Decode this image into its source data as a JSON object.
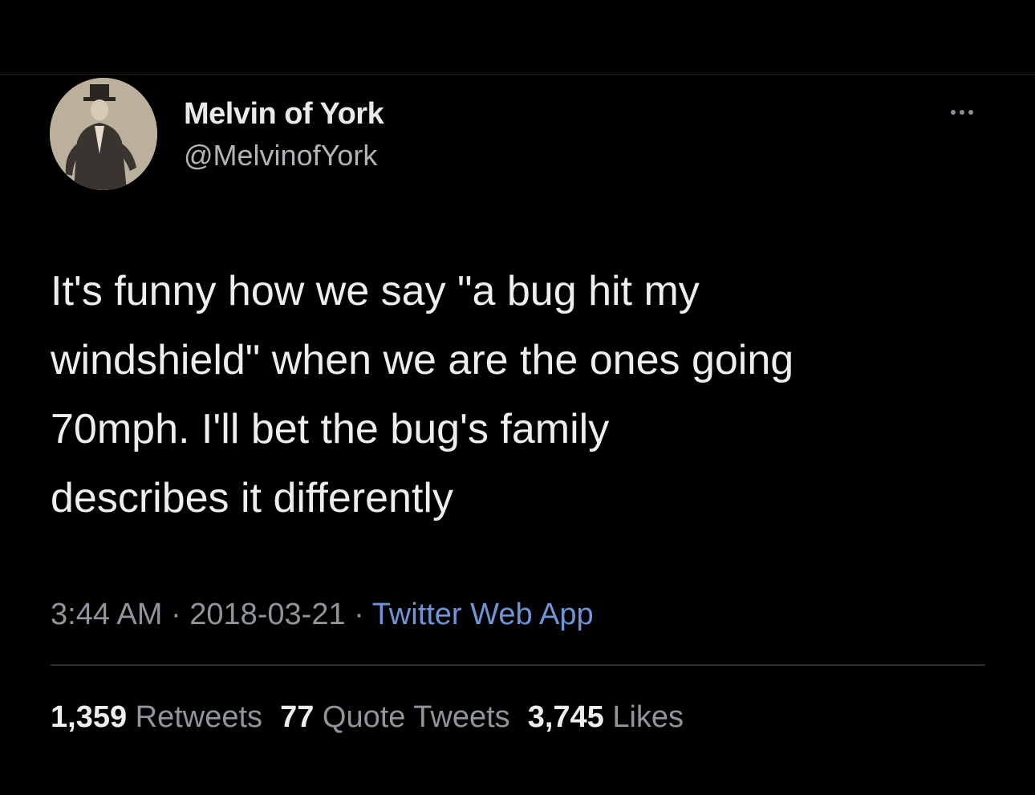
{
  "tweet": {
    "author": {
      "display_name": "Melvin of York",
      "handle": "@MelvinofYork"
    },
    "text": "It's funny how we say \"a bug hit my\nwindshield\" when we are the ones going\n70mph. I'll bet the bug's family\ndescribes it differently",
    "time": "3:44 AM",
    "date": "2018-03-21",
    "separator": "·",
    "source": "Twitter Web App",
    "stats": {
      "retweets_count": "1,359",
      "retweets_label": "Retweets",
      "quotes_count": "77",
      "quotes_label": "Quote Tweets",
      "likes_count": "3,745",
      "likes_label": "Likes"
    },
    "icons": {
      "more": "more-horizontal-icon",
      "avatar": "avatar-image"
    }
  },
  "colors": {
    "background": "#000000",
    "primary_text": "#eceeef",
    "secondary_text": "#8f959a",
    "link": "#6f95d6",
    "divider": "#2a2d30"
  }
}
